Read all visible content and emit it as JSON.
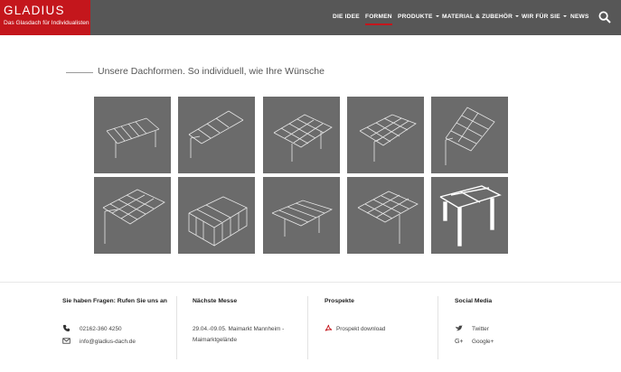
{
  "header": {
    "brand": "GLADIUS",
    "tagline": "Das Glasdach für Individualisten",
    "nav": [
      {
        "label": "DIE IDEE",
        "dropdown": false,
        "active": false
      },
      {
        "label": "FORMEN",
        "dropdown": false,
        "active": true
      },
      {
        "label": "PRODUKTE",
        "dropdown": true,
        "active": false
      },
      {
        "label": "MATERIAL & ZUBEHÖR",
        "dropdown": true,
        "active": false
      },
      {
        "label": "WIR FÜR SIE",
        "dropdown": true,
        "active": false
      },
      {
        "label": "NEWS",
        "dropdown": false,
        "active": false
      }
    ],
    "colors": {
      "bar": "#575757",
      "brand": "#c4161c"
    }
  },
  "main": {
    "headline": "Unsere Dachformen. So individuell, wie Ihre Wünsche",
    "tile_count": 10
  },
  "footer": {
    "contact": {
      "title": "Sie haben Fragen: Rufen Sie uns an",
      "phone": "02162-360 4250",
      "email": "info@gladius-dach.de"
    },
    "next_fair": {
      "title": "Nächste Messe",
      "line1": "29.04.-09.05. Maimarkt Mannheim -",
      "line2": "Maimarktgelände"
    },
    "brochures": {
      "title": "Prospekte",
      "link": "Prospekt download"
    },
    "social": {
      "title": "Social Media",
      "twitter": "Twitter",
      "google": "Google+"
    }
  }
}
